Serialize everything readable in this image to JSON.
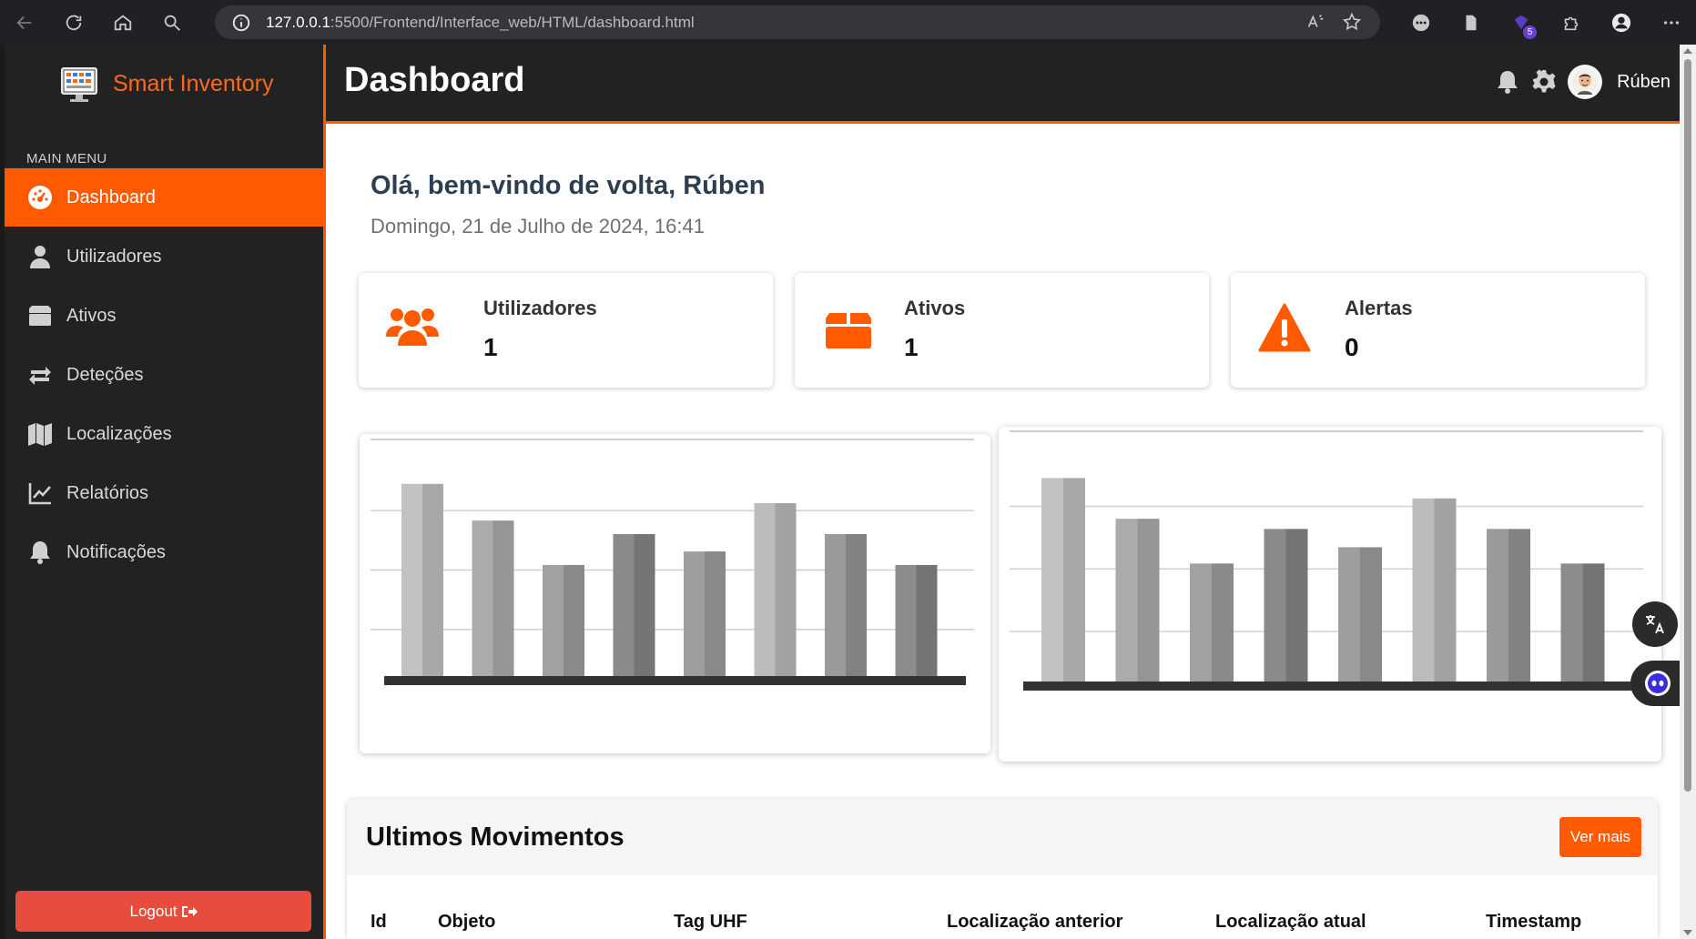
{
  "browser": {
    "url_host": "127.0.0.1",
    "url_path": ":5500/Frontend/Interface_web/HTML/dashboard.html",
    "extension_badge": "5"
  },
  "sidebar": {
    "brand": "Smart Inventory",
    "menu_label": "MAIN MENU",
    "items": [
      {
        "label": "Dashboard",
        "icon": "gauge-icon",
        "active": true
      },
      {
        "label": "Utilizadores",
        "icon": "user-icon"
      },
      {
        "label": "Ativos",
        "icon": "box-icon"
      },
      {
        "label": "Deteções",
        "icon": "exchange-icon"
      },
      {
        "label": "Localizações",
        "icon": "map-icon"
      },
      {
        "label": "Relatórios",
        "icon": "line-chart-icon"
      },
      {
        "label": "Notificações",
        "icon": "bell-icon"
      }
    ],
    "logout": "Logout"
  },
  "header": {
    "title": "Dashboard",
    "user_name": "Rúben"
  },
  "main": {
    "greeting": "Olá, bem-vindo de volta, Rúben",
    "datetime": "Domingo, 21 de Julho de 2024, 16:41",
    "stats": [
      {
        "label": "Utilizadores",
        "value": "1",
        "icon": "users-icon"
      },
      {
        "label": "Ativos",
        "value": "1",
        "icon": "box-icon"
      },
      {
        "label": "Alertas",
        "value": "0",
        "icon": "warning-icon"
      }
    ],
    "movements": {
      "title": "Ultimos Movimentos",
      "button": "Ver mais",
      "columns": [
        "Id",
        "Objeto",
        "Tag UHF",
        "Localização anterior",
        "Localização atual",
        "Timestamp"
      ]
    }
  },
  "colors": {
    "accent": "#ff5a00",
    "sidebar_bg": "#222222",
    "logout": "#e74c3c"
  },
  "chart_data": [
    {
      "type": "bar",
      "title": "",
      "categories": [
        "",
        "",
        "",
        "",
        "",
        "",
        "",
        ""
      ],
      "values": [
        100,
        81,
        58,
        74,
        65,
        90,
        74,
        58
      ],
      "ylim": [
        0,
        123
      ],
      "grid": true
    },
    {
      "type": "bar",
      "title": "",
      "categories": [
        "",
        "",
        "",
        "",
        "",
        "",
        "",
        ""
      ],
      "values": [
        100,
        80,
        58,
        75,
        66,
        90,
        75,
        58
      ],
      "ylim": [
        0,
        123
      ],
      "grid": true
    }
  ]
}
